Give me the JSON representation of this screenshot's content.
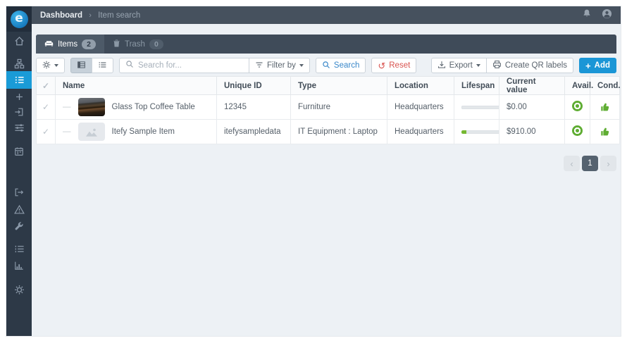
{
  "topbar": {
    "breadcrumb": {
      "root": "Dashboard",
      "separator": "›",
      "current": "Item search"
    },
    "icons": [
      "bell-icon",
      "user-icon"
    ]
  },
  "sidebar": {
    "logo_letter": "e",
    "items": [
      {
        "icon": "home-icon"
      },
      {
        "icon": "sitemap-icon"
      },
      {
        "icon": "list-icon",
        "active": true
      },
      {
        "icon": "plus-icon"
      },
      {
        "icon": "checkin-icon"
      },
      {
        "icon": "sliders-icon"
      },
      {
        "icon": "calendar-icon"
      },
      {
        "icon": "checkout-icon"
      },
      {
        "icon": "warning-icon"
      },
      {
        "icon": "wrench-icon"
      },
      {
        "icon": "list-bullets-icon"
      },
      {
        "icon": "bar-chart-icon"
      },
      {
        "icon": "gear-icon"
      }
    ]
  },
  "tabs": {
    "items": {
      "label": "Items",
      "count": "2"
    },
    "trash": {
      "label": "Trash",
      "count": "0"
    }
  },
  "toolbar": {
    "search_placeholder": "Search for...",
    "filter_by": "Filter by",
    "search": "Search",
    "reset": "Reset",
    "reset_glyph": "↺",
    "export": "Export",
    "create_qr": "Create QR labels",
    "add": "Add",
    "plus_glyph": "+"
  },
  "table": {
    "check_glyph": "✓",
    "expand_dash": "—",
    "headers": {
      "name": "Name",
      "unique_id": "Unique ID",
      "type": "Type",
      "location": "Location",
      "lifespan": "Lifespan",
      "current_value": "Current value",
      "avail": "Avail.",
      "cond": "Cond."
    },
    "rows": [
      {
        "name": "Glass Top Coffee Table",
        "unique_id": "12345",
        "type": "Furniture",
        "location": "Headquarters",
        "lifespan_pct": "0%",
        "current_value": "$0.00",
        "avail_icon": "green-dot-circle",
        "cond_icon": "green-thumbs-up"
      },
      {
        "name": "Itefy Sample Item",
        "unique_id": "itefysampledata",
        "type": "IT Equipment : Laptop",
        "location": "Headquarters",
        "lifespan_pct": "12%",
        "current_value": "$910.00",
        "avail_icon": "green-dot-circle",
        "cond_icon": "green-thumbs-up"
      }
    ]
  },
  "pagination": {
    "prev": "‹",
    "current": "1",
    "next": "›"
  },
  "colors": {
    "sidebar_bg": "#2d3947",
    "topbar_bg": "#46515e",
    "tabbar_bg": "#3f4b59",
    "active_blue": "#1a9bd7",
    "add_blue": "#1a96d6",
    "link_blue": "#3987c9",
    "reset_red": "#d9534f",
    "status_green": "#5fad33",
    "content_bg": "#edf1f5"
  }
}
